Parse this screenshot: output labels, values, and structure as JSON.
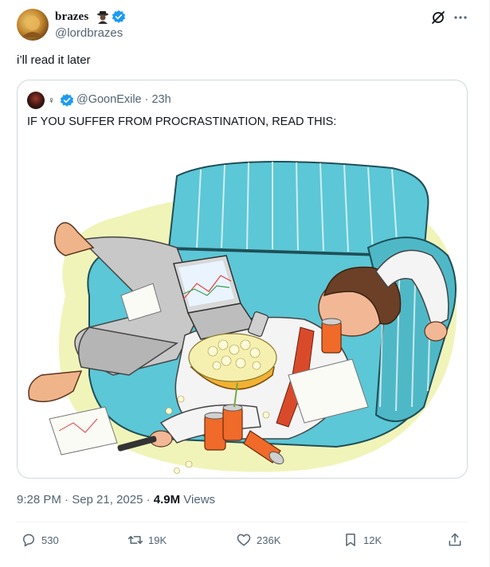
{
  "author": {
    "display_name": "brazes",
    "handle": "@lordbrazes"
  },
  "tweet": {
    "text": "i’ll read it later"
  },
  "quoted": {
    "handle_time": "@GoonExile · 23h",
    "text": "IF YOU SUFFER FROM PROCRASTINATION, READ THIS:",
    "badge": "♀"
  },
  "meta": {
    "time_date": "9:28 PM · Sep 21, 2025 · ",
    "views_count": "4.9M",
    "views_label": " Views"
  },
  "actions": {
    "replies": "530",
    "retweets": "19K",
    "likes": "236K",
    "bookmarks": "12K"
  },
  "colors": {
    "verified": "#1d9bf0",
    "secondary_text": "#536471",
    "border": "#cfd9de",
    "couch": "#5cc7d6"
  },
  "icons": [
    "grok-icon",
    "more-icon",
    "verified-icon",
    "reply-icon",
    "retweet-icon",
    "like-icon",
    "bookmark-icon",
    "share-icon"
  ]
}
